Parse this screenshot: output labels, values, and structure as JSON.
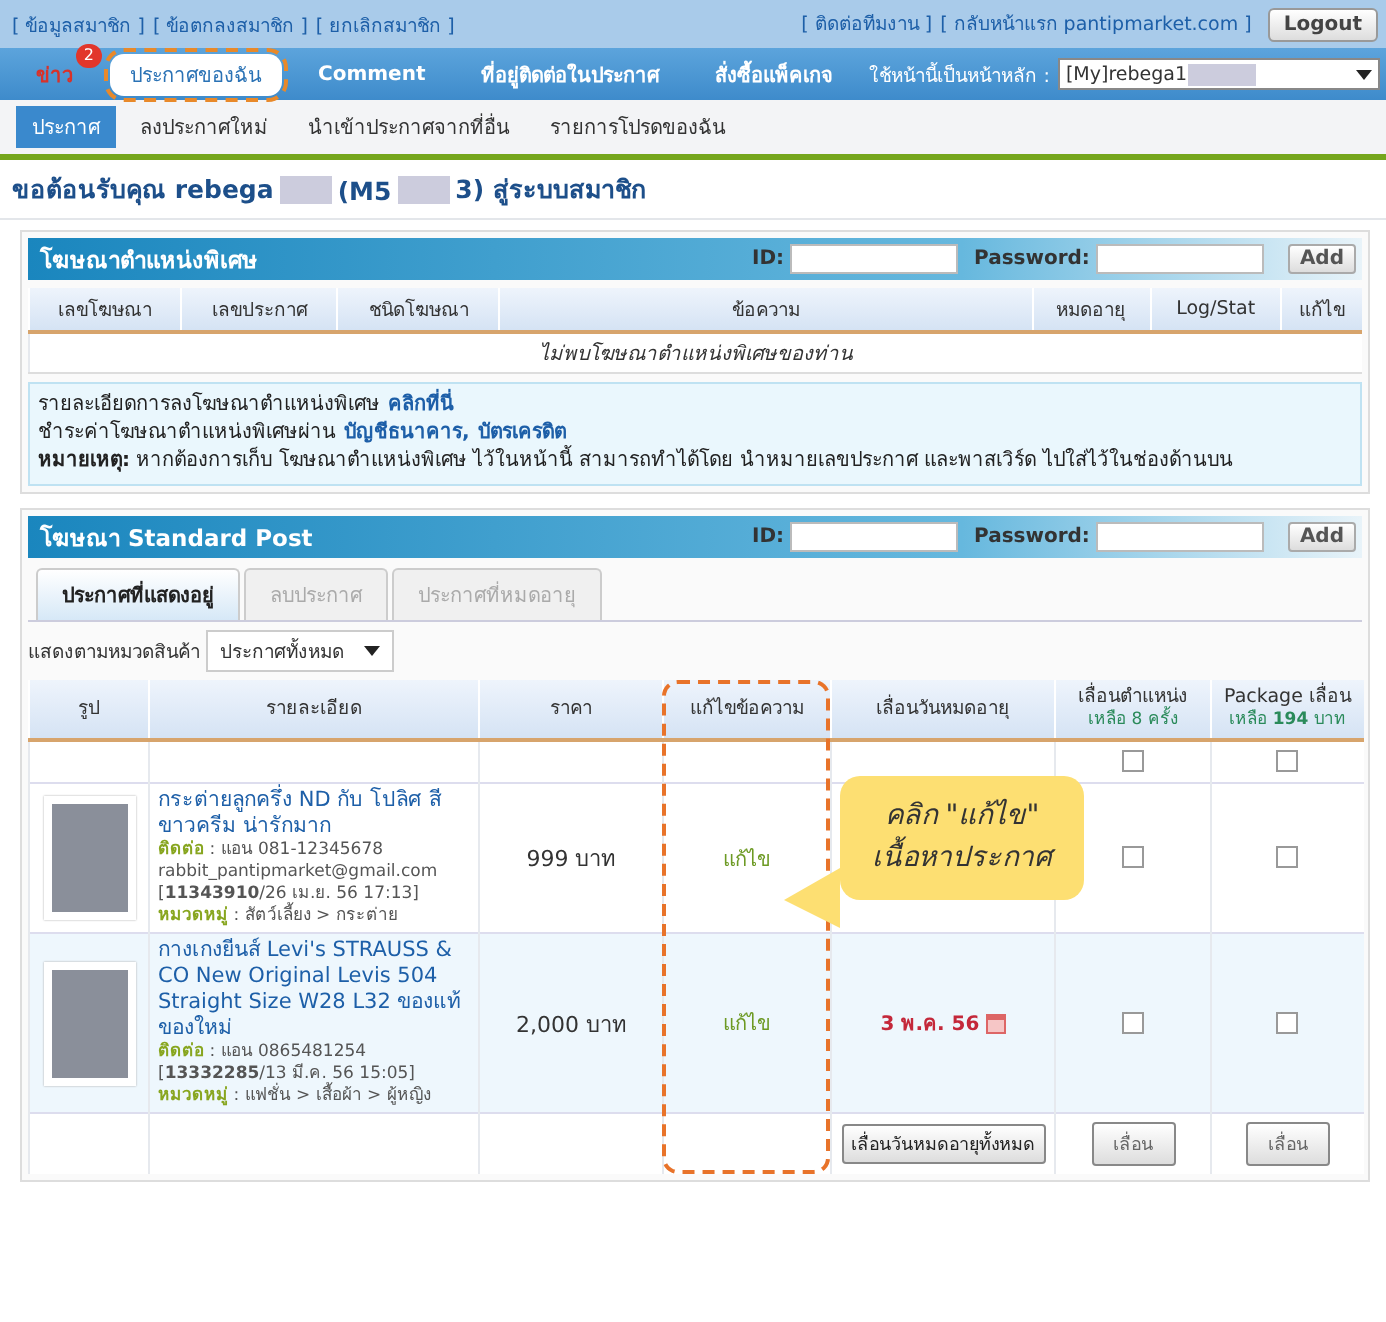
{
  "top_bar": {
    "left_links": [
      "[ ข้อมูลสมาชิก ]",
      "[ ข้อตกลงสมาชิก ]",
      "[ ยกเลิกสมาชิก ]"
    ],
    "right_links": [
      "[ ติดต่อทีมงาน ]",
      "[ กลับหน้าแรก pantipmarket.com ]"
    ],
    "logout": "Logout"
  },
  "nav": {
    "items": [
      {
        "label": "ข่าว",
        "badge": "2",
        "selected": false
      },
      {
        "label": "ประกาศของฉัน",
        "selected": true,
        "highlighted": true
      },
      {
        "label": "Comment",
        "selected": false
      },
      {
        "label": "ที่อยู่ติดต่อในประกาศ",
        "selected": false
      },
      {
        "label": "สั่งซื้อแพ็คเกจ",
        "selected": false
      }
    ],
    "home_label": "ใช้หน้านี้เป็นหน้าหลัก :",
    "home_value": "[My]rebega1"
  },
  "subnav": [
    {
      "label": "ประกาศ",
      "selected": true
    },
    {
      "label": "ลงประกาศใหม่",
      "selected": false
    },
    {
      "label": "นำเข้าประกาศจากที่อื่น",
      "selected": false
    },
    {
      "label": "รายการโปรดของฉัน",
      "selected": false
    }
  ],
  "welcome": [
    {
      "kind": "text",
      "text": "ขอต้อนรับคุณ rebega"
    },
    {
      "kind": "redacted"
    },
    {
      "kind": "text",
      "text": "(M5"
    },
    {
      "kind": "redacted"
    },
    {
      "kind": "text",
      "text": "3) สู่ระบบสมาชิก"
    }
  ],
  "special_ads": {
    "title": "โฆษณาตำแหน่งพิเศษ",
    "id_label": "ID:",
    "password_label": "Password:",
    "add": "Add",
    "columns": [
      "เลขโฆษณา",
      "เลขประกาศ",
      "ชนิดโฆษณา",
      "ข้อความ",
      "หมดอายุ",
      "Log/Stat",
      "แก้ไข"
    ],
    "empty": "ไม่พบโฆษณาตำแหน่งพิเศษของท่าน",
    "info": [
      [
        {
          "text": "รายละเอียดการลงโฆษณาตำแหน่งพิเศษ",
          "link": false
        },
        {
          "text": "คลิกที่นี่",
          "link": true
        }
      ],
      [
        {
          "text": "ชำระค่าโฆษณาตำแหน่งพิเศษผ่าน",
          "link": false
        },
        {
          "text": "บัญชีธนาคาร,",
          "link": true
        },
        {
          "text": "บัตรเครดิต",
          "link": true
        }
      ],
      [
        {
          "text": "**หมายเหตุ:** หากต้องการเก็บ โฆษณาตำแหน่งพิเศษ ไว้ในหน้านี้ สามารถทำได้โดย นำหมายเลขประกาศ และพาสเวิร์ด ไปใส่ไว้ในช่องด้านบน",
          "link": false
        }
      ]
    ]
  },
  "standard_post": {
    "title": "โฆษณา Standard Post",
    "id_label": "ID:",
    "password_label": "Password:",
    "add": "Add",
    "tabs": [
      {
        "label": "ประกาศที่แสดงอยู่",
        "selected": true
      },
      {
        "label": "ลบประกาศ",
        "selected": false
      },
      {
        "label": "ประกาศที่หมดอายุ",
        "selected": false
      }
    ],
    "filter_label": "แสดงตามหมวดสินค้า",
    "filter_value": "ประกาศทั้งหมด",
    "columns": [
      {
        "label": "รูป"
      },
      {
        "label": "รายละเอียด"
      },
      {
        "label": "ราคา"
      },
      {
        "label": "แก้ไขข้อความ",
        "highlighted": true
      },
      {
        "label": "เลื่อนวันหมดอายุ"
      },
      {
        "label": "เลื่อนตำแหน่ง",
        "sub": "เหลือ 8 ครั้ง"
      },
      {
        "label": "Package เลื่อน",
        "sub": "เหลือ **194** บาท"
      }
    ],
    "select_all": [
      {
        "checked": false
      },
      {
        "checked": false
      }
    ],
    "rows": [
      {
        "title": "กระต่ายลูกครึ่ง ND กับ โปลิศ สีขาวครีม น่ารักมาก",
        "contact": "**ติดต่อ** : แอน 081-12345678",
        "email": "rabbit_pantipmarket@gmail.com",
        "ref": "[**11343910**/26 เม.ย. 56 17:13]",
        "category": "**หมวดหมู่** : สัตว์เลี้ยง > กระต่าย",
        "price": "999 บาท",
        "edit": "แก้ไข",
        "bump": {
          "checked": false
        },
        "package": {
          "checked": false
        }
      },
      {
        "title": "กางเกงยีนส์ Levi's STRAUSS & CO New Original Levis 504 Straight Size W28 L32 ของแท้ ของใหม่",
        "contact": "**ติดต่อ** : แอน 0865481254",
        "ref": "[**13332285**/13 มี.ค. 56 15:05]",
        "category": "**หมวดหมู่** : แฟชั่น > เสื้อผ้า > ผู้หญิง",
        "price": "2,000 บาท",
        "edit": "แก้ไข",
        "expiry": "3 พ.ค. 56",
        "bump": {
          "checked": false
        },
        "package": {
          "checked": false
        }
      }
    ],
    "footer_buttons": [
      "เลื่อนวันหมดอายุทั้งหมด",
      "เลื่อน",
      "เลื่อน"
    ],
    "callout": [
      "คลิก \"แก้ไข\"",
      "เนื้อหาประกาศ"
    ]
  }
}
